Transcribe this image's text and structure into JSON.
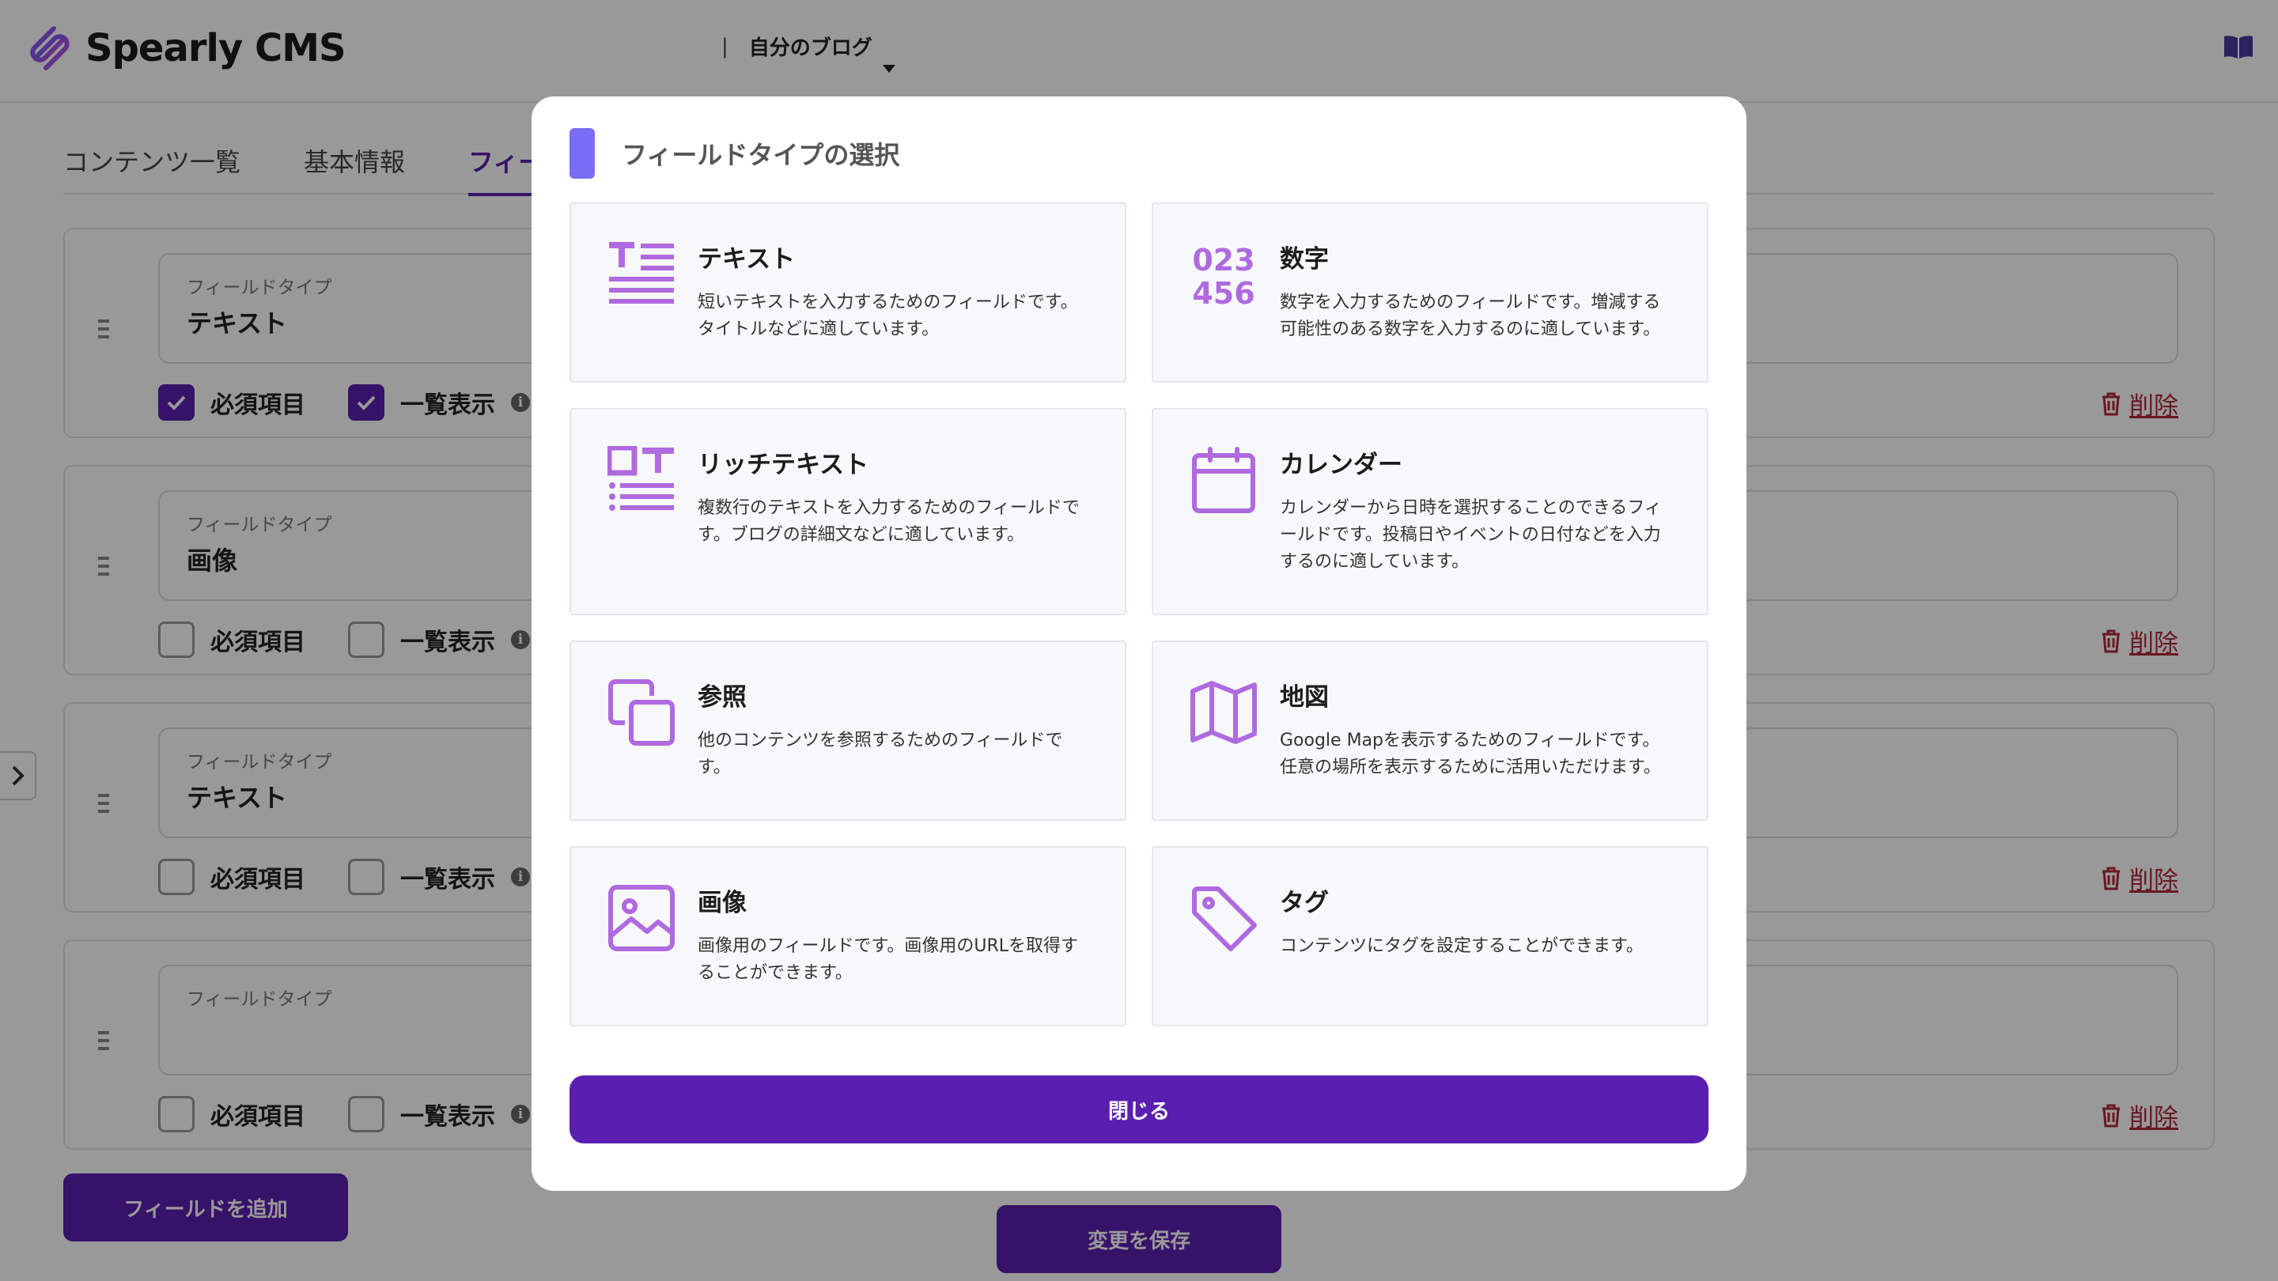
{
  "header": {
    "brand": "Spearly CMS",
    "separator": "|",
    "site_name": "自分のブログ"
  },
  "tabs": [
    {
      "label": "コンテンツ一覧"
    },
    {
      "label": "基本情報"
    },
    {
      "label": "フィー"
    }
  ],
  "fields": [
    {
      "type_label": "フィールドタイプ",
      "type_value": "テキスト",
      "required_label": "必須項目",
      "required": true,
      "list_label": "一覧表示",
      "list": true,
      "delete_label": "削除"
    },
    {
      "type_label": "フィールドタイプ",
      "type_value": "画像",
      "required_label": "必須項目",
      "required": false,
      "list_label": "一覧表示",
      "list": false,
      "delete_label": "削除"
    },
    {
      "type_label": "フィールドタイプ",
      "type_value": "テキスト",
      "required_label": "必須項目",
      "required": false,
      "list_label": "一覧表示",
      "list": false,
      "delete_label": "削除"
    },
    {
      "type_label": "フィールドタイプ",
      "type_value": "",
      "required_label": "必須項目",
      "required": false,
      "list_label": "一覧表示",
      "list": false,
      "delete_label": "削除"
    }
  ],
  "actions": {
    "add_field": "フィールドを追加",
    "save": "変更を保存"
  },
  "modal": {
    "title": "フィールドタイプの選択",
    "close": "閉じる",
    "accent_color": "#7b6cf6",
    "icon_color": "#b06ae0",
    "types": [
      {
        "name": "テキスト",
        "desc": "短いテキストを入力するためのフィールドです。タイトルなどに適しています。",
        "icon": "text-lines-icon"
      },
      {
        "name": "数字",
        "desc": "数字を入力するためのフィールドです。増減する可能性のある数字を入力するのに適しています。",
        "icon": "numbers-icon",
        "icon_text_1": "023",
        "icon_text_2": "456"
      },
      {
        "name": "リッチテキスト",
        "desc": "複数行のテキストを入力するためのフィールドです。ブログの詳細文などに適しています。",
        "icon": "rich-text-icon"
      },
      {
        "name": "カレンダー",
        "desc": "カレンダーから日時を選択することのできるフィールドです。投稿日やイベントの日付などを入力するのに適しています。",
        "icon": "calendar-icon"
      },
      {
        "name": "参照",
        "desc": "他のコンテンツを参照するためのフィールドです。",
        "icon": "copy-icon"
      },
      {
        "name": "地図",
        "desc": "Google Mapを表示するためのフィールドです。任意の場所を表示するために活用いただけます。",
        "icon": "map-icon"
      },
      {
        "name": "画像",
        "desc": "画像用のフィールドです。画像用のURLを取得することができます。",
        "icon": "image-icon"
      },
      {
        "name": "タグ",
        "desc": "コンテンツにタグを設定することができます。",
        "icon": "tag-icon"
      }
    ]
  },
  "colors": {
    "primary": "#5a1fb0",
    "danger": "#b0293a"
  }
}
